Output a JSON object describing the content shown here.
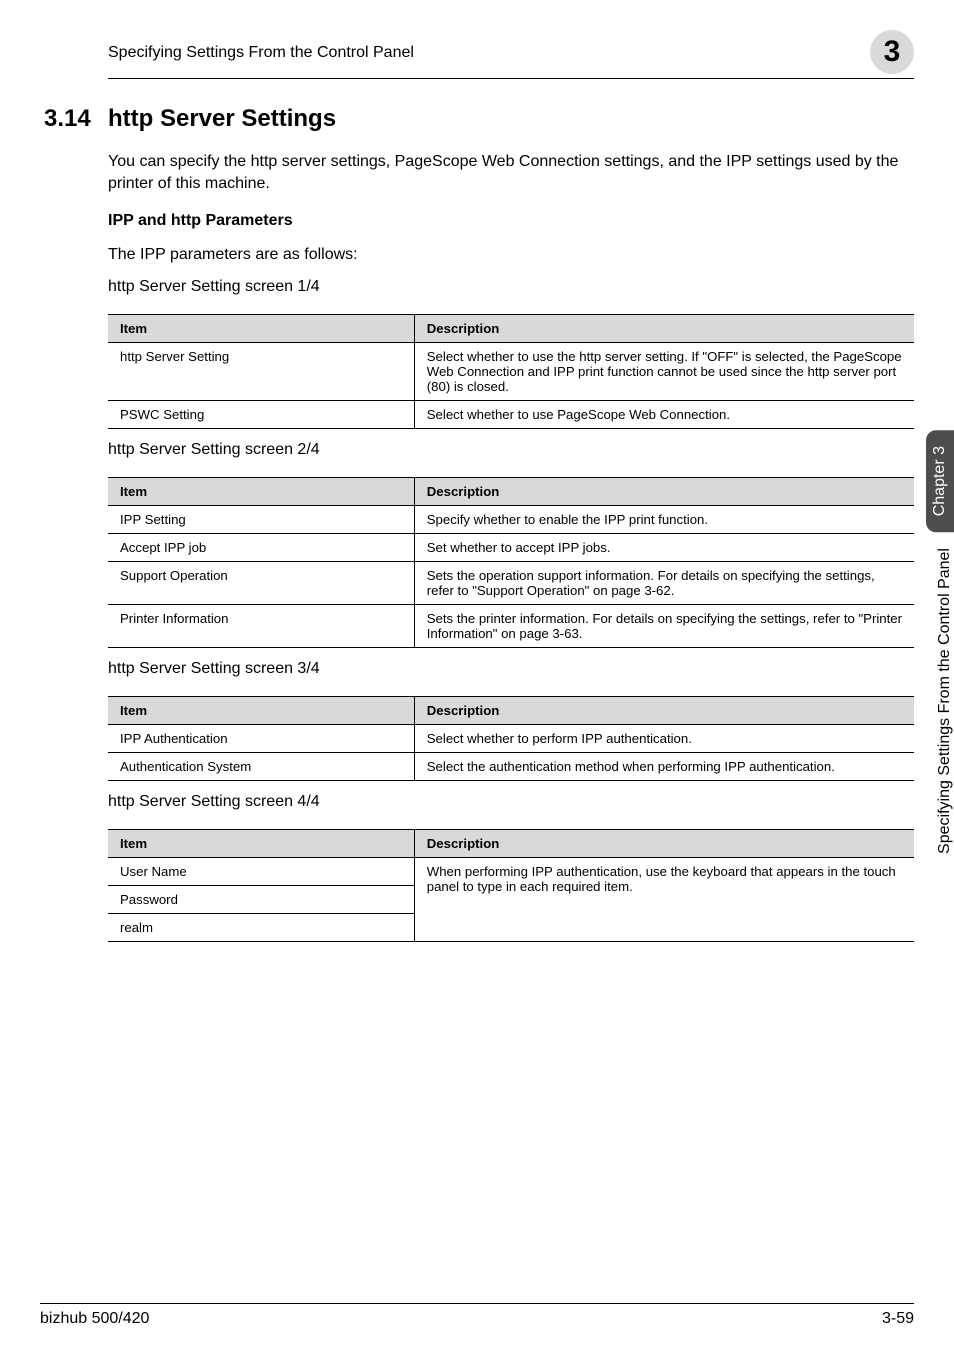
{
  "header": {
    "title": "Specifying Settings From the Control Panel",
    "chapter_number": "3"
  },
  "section": {
    "number": "3.14",
    "title": "http Server Settings",
    "intro": "You can specify the http server settings, PageScope Web Connection settings, and the IPP settings used by the printer of this machine.",
    "sub_title": "IPP and http Parameters",
    "sub_intro": "The IPP parameters are as follows:"
  },
  "captions": {
    "t1": "http Server Setting screen 1/4",
    "t2": "http Server Setting screen 2/4",
    "t3": "http Server Setting screen 3/4",
    "t4": "http Server Setting screen 4/4"
  },
  "headers": {
    "item": "Item",
    "desc": "Description"
  },
  "table1": {
    "r1": {
      "item": "http Server Setting",
      "desc": "Select whether to use the http server setting. If \"OFF\" is selected, the PageScope Web Connection and IPP print function cannot be used since the http server port (80) is closed."
    },
    "r2": {
      "item": "PSWC Setting",
      "desc": "Select whether to use PageScope Web Connection."
    }
  },
  "table2": {
    "r1": {
      "item": "IPP Setting",
      "desc": "Specify whether to enable the IPP print function."
    },
    "r2": {
      "item": "Accept IPP job",
      "desc": "Set whether to accept IPP jobs."
    },
    "r3": {
      "item": "Support Operation",
      "desc": "Sets the operation support information. For details on specifying the settings, refer to \"Support Operation\" on page 3-62."
    },
    "r4": {
      "item": "Printer Information",
      "desc": "Sets the printer information. For details on specifying the settings, refer to \"Printer Information\" on page 3-63."
    }
  },
  "table3": {
    "r1": {
      "item": "IPP Authentication",
      "desc": "Select whether to perform IPP authentication."
    },
    "r2": {
      "item": "Authentication System",
      "desc": "Select the authentication method when performing IPP authentication."
    }
  },
  "table4": {
    "r1": {
      "item": "User Name"
    },
    "r2": {
      "item": "Password"
    },
    "r3": {
      "item": "realm"
    },
    "desc": "When performing IPP authentication, use the keyboard that appears in the touch panel to type in each required item."
  },
  "side_tab": {
    "top": "Chapter 3",
    "bottom": "Specifying Settings From the Control Panel"
  },
  "footer": {
    "left": "bizhub 500/420",
    "right": "3-59"
  }
}
